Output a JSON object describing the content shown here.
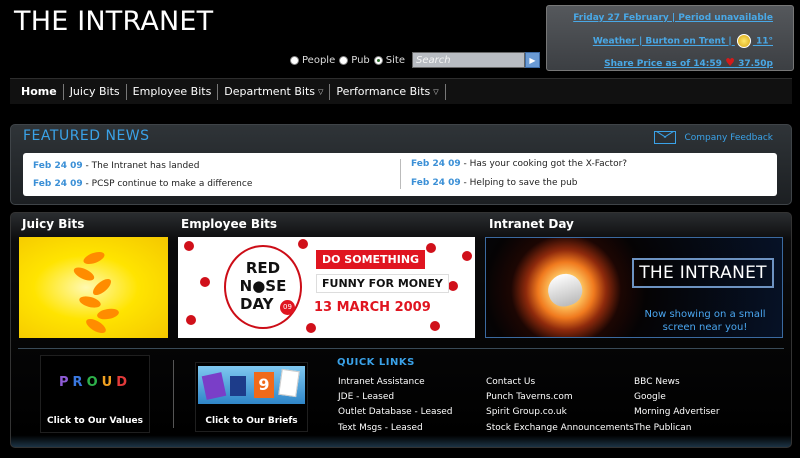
{
  "header": {
    "title": "THE INTRANET",
    "search_options": [
      "People",
      "Pub",
      "Site"
    ],
    "selected_option": "Site",
    "search_placeholder": "Search",
    "search_button_glyph": "▶"
  },
  "info_box": {
    "date_line": "Friday 27 February | Period unavailable",
    "weather_label": "Weather | Burton on Trent |",
    "weather_temp": "11°",
    "weather_icon": "sun-cloud-icon",
    "share_label": "Share Price as of 14:59",
    "share_icon": "heart-icon",
    "share_value": "37.50p"
  },
  "nav": {
    "items": [
      {
        "label": "Home",
        "dropdown": false
      },
      {
        "label": "Juicy Bits",
        "dropdown": false
      },
      {
        "label": "Employee Bits",
        "dropdown": false
      },
      {
        "label": "Department Bits",
        "dropdown": true
      },
      {
        "label": "Performance Bits",
        "dropdown": true
      }
    ],
    "chevron": "▽"
  },
  "featured": {
    "title": "FEATURED NEWS",
    "feedback": "Company Feedback",
    "news": [
      {
        "date": "Feb 24 09",
        "text": "- The Intranet has landed"
      },
      {
        "date": "Feb 24 09",
        "text": "- PCSP continue to make a difference"
      },
      {
        "date": "Feb 24 09",
        "text": "- Has your cooking got the X-Factor?"
      },
      {
        "date": "Feb 24 09",
        "text": "- Helping to save the pub"
      }
    ]
  },
  "sections": {
    "juicy": "Juicy Bits",
    "employee": "Employee Bits",
    "intranet_day": "Intranet Day"
  },
  "red_nose": {
    "line1": "RED",
    "line2": "N●SE",
    "line3": "DAY",
    "year": "09",
    "do_something": "DO SOMETHING",
    "funny": "FUNNY FOR MONEY",
    "date": "13 MARCH 2009"
  },
  "intranet_day_banner": {
    "title": "THE INTRANET",
    "subtitle": "Now showing on a small screen near you!"
  },
  "promos": {
    "proud": "PROUD",
    "proud_caption": "Click to Our Values",
    "briefs_caption": "Click to Our Briefs",
    "briefs_number": "9"
  },
  "quick_links": {
    "title": "QUICK LINKS",
    "col1": [
      "Intranet Assistance",
      "JDE - Leased",
      "Outlet Database - Leased",
      "Text Msgs - Leased"
    ],
    "col2": [
      "Contact Us",
      "Punch Taverns.com",
      "Spirit Group.co.uk",
      "Stock Exchange Announcements"
    ],
    "col3": [
      "BBC News",
      "Google",
      "Morning Advertiser",
      "The Publican"
    ]
  },
  "colors": {
    "accent_blue": "#3aa2e8",
    "red": "#e01520"
  }
}
